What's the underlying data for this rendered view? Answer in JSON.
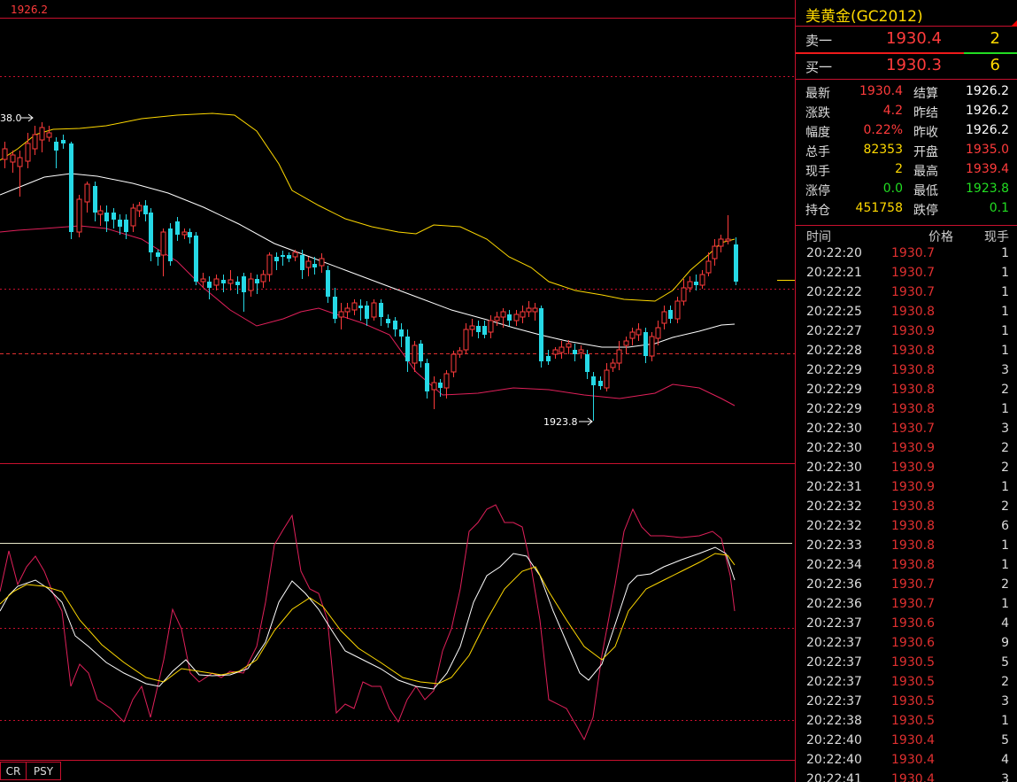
{
  "chart": {
    "ref_price_label": "1926.2",
    "high_marker_label": "38.0",
    "low_marker_label": "1923.8",
    "colors": {
      "up": "#ff3b3b",
      "down": "#26d9e6",
      "upper_band": "#ffd900",
      "mid_band": "#ffffff",
      "lower_band": "#e0205a",
      "grid": "#c8102e"
    }
  },
  "tabs": [
    {
      "label": "CR"
    },
    {
      "label": "PSY"
    }
  ],
  "quote": {
    "title": "美黄金(GC2012)",
    "ask": {
      "label": "卖一",
      "price": "1930.4",
      "volume": "2"
    },
    "bid": {
      "label": "买一",
      "price": "1930.3",
      "volume": "6"
    },
    "stats": [
      {
        "k1": "最新",
        "v1": "1930.4",
        "c1": "#ff3b3b",
        "k2": "结算",
        "v2": "1926.2",
        "c2": "#ffffff"
      },
      {
        "k1": "涨跌",
        "v1": "4.2",
        "c1": "#ff3b3b",
        "k2": "昨结",
        "v2": "1926.2",
        "c2": "#ffffff"
      },
      {
        "k1": "幅度",
        "v1": "0.22%",
        "c1": "#ff3b3b",
        "k2": "昨收",
        "v2": "1926.2",
        "c2": "#ffffff"
      },
      {
        "k1": "总手",
        "v1": "82353",
        "c1": "#ffd900",
        "k2": "开盘",
        "v2": "1935.0",
        "c2": "#ff3b3b"
      },
      {
        "k1": "现手",
        "v1": "2",
        "c1": "#ffd900",
        "k2": "最高",
        "v2": "1939.4",
        "c2": "#ff3b3b"
      },
      {
        "k1": "涨停",
        "v1": "0.0",
        "c1": "#22dd22",
        "k2": "最低",
        "v2": "1923.8",
        "c2": "#22dd22"
      },
      {
        "k1": "持仓",
        "v1": "451758",
        "c1": "#ffd900",
        "k2": "跌停",
        "v2": "0.1",
        "c2": "#22dd22"
      }
    ]
  },
  "ticks": {
    "headers": {
      "time": "时间",
      "price": "价格",
      "volume": "现手"
    },
    "rows": [
      {
        "time": "20:22:20",
        "price": "1930.7",
        "volume": "1"
      },
      {
        "time": "20:22:21",
        "price": "1930.7",
        "volume": "1"
      },
      {
        "time": "20:22:22",
        "price": "1930.7",
        "volume": "1"
      },
      {
        "time": "20:22:25",
        "price": "1930.8",
        "volume": "1"
      },
      {
        "time": "20:22:27",
        "price": "1930.9",
        "volume": "1"
      },
      {
        "time": "20:22:28",
        "price": "1930.8",
        "volume": "1"
      },
      {
        "time": "20:22:29",
        "price": "1930.8",
        "volume": "3"
      },
      {
        "time": "20:22:29",
        "price": "1930.8",
        "volume": "2"
      },
      {
        "time": "20:22:29",
        "price": "1930.8",
        "volume": "1"
      },
      {
        "time": "20:22:30",
        "price": "1930.7",
        "volume": "3"
      },
      {
        "time": "20:22:30",
        "price": "1930.9",
        "volume": "2"
      },
      {
        "time": "20:22:30",
        "price": "1930.9",
        "volume": "2"
      },
      {
        "time": "20:22:31",
        "price": "1930.9",
        "volume": "1"
      },
      {
        "time": "20:22:32",
        "price": "1930.8",
        "volume": "2"
      },
      {
        "time": "20:22:32",
        "price": "1930.8",
        "volume": "6"
      },
      {
        "time": "20:22:33",
        "price": "1930.8",
        "volume": "1"
      },
      {
        "time": "20:22:34",
        "price": "1930.8",
        "volume": "1"
      },
      {
        "time": "20:22:36",
        "price": "1930.7",
        "volume": "2"
      },
      {
        "time": "20:22:36",
        "price": "1930.7",
        "volume": "1"
      },
      {
        "time": "20:22:37",
        "price": "1930.6",
        "volume": "4"
      },
      {
        "time": "20:22:37",
        "price": "1930.6",
        "volume": "9"
      },
      {
        "time": "20:22:37",
        "price": "1930.5",
        "volume": "5"
      },
      {
        "time": "20:22:37",
        "price": "1930.5",
        "volume": "2"
      },
      {
        "time": "20:22:37",
        "price": "1930.5",
        "volume": "3"
      },
      {
        "time": "20:22:38",
        "price": "1930.5",
        "volume": "1"
      },
      {
        "time": "20:22:40",
        "price": "1930.4",
        "volume": "5"
      },
      {
        "time": "20:22:40",
        "price": "1930.4",
        "volume": "4"
      },
      {
        "time": "20:22:41",
        "price": "1930.4",
        "volume": "3"
      }
    ]
  }
}
